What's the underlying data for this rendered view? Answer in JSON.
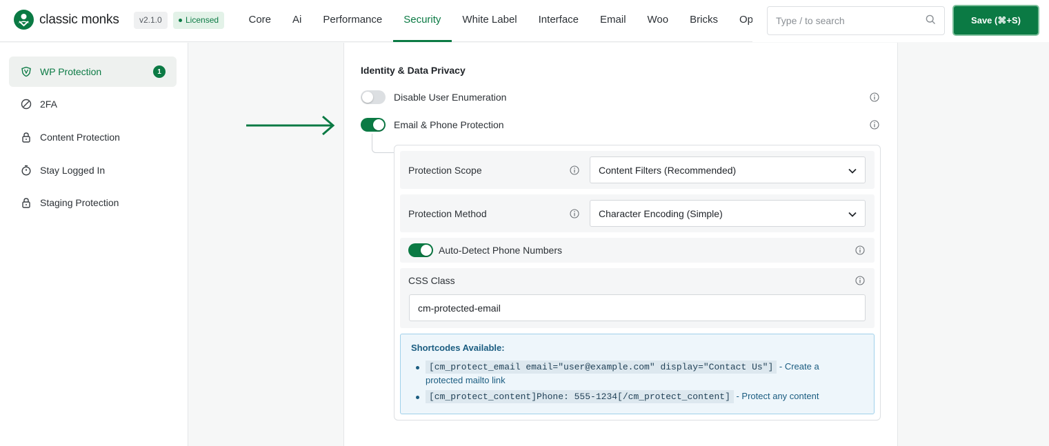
{
  "brand": {
    "name": "classic monks",
    "version": "v2.1.0",
    "license": "Licensed"
  },
  "nav": {
    "tabs": [
      "Core",
      "Ai",
      "Performance",
      "Security",
      "White Label",
      "Interface",
      "Email",
      "Woo",
      "Bricks",
      "Opt"
    ],
    "active_tab": "Security"
  },
  "search": {
    "placeholder": "Type / to search"
  },
  "save": {
    "label": "Save (⌘+S)"
  },
  "sidebar": {
    "items": [
      {
        "label": "WP Protection",
        "icon": "shield-icon",
        "badge": "1",
        "active": true
      },
      {
        "label": "2FA",
        "icon": "slash-circle-icon"
      },
      {
        "label": "Content Protection",
        "icon": "lock-icon"
      },
      {
        "label": "Stay Logged In",
        "icon": "stopwatch-icon"
      },
      {
        "label": "Staging Protection",
        "icon": "lock-icon"
      }
    ]
  },
  "section": {
    "title": "Identity & Data Privacy",
    "disable_user_enum": {
      "label": "Disable User Enumeration",
      "enabled": false
    },
    "email_phone": {
      "label": "Email & Phone Protection",
      "enabled": true
    }
  },
  "subpanel": {
    "scope": {
      "label": "Protection Scope",
      "value": "Content Filters (Recommended)"
    },
    "method": {
      "label": "Protection Method",
      "value": "Character Encoding (Simple)"
    },
    "auto_detect": {
      "label": "Auto-Detect Phone Numbers",
      "enabled": true
    },
    "css_class": {
      "label": "CSS Class",
      "value": "cm-protected-email"
    },
    "shortcodes": {
      "title": "Shortcodes Available:",
      "items": [
        {
          "code": "[cm_protect_email email=\"user@example.com\" display=\"Contact Us\"]",
          "desc": " - Create a protected mailto link"
        },
        {
          "code": "[cm_protect_content]Phone: 555-1234[/cm_protect_content]",
          "desc": " - Protect any content"
        }
      ]
    }
  },
  "colors": {
    "accent": "#0b7a44",
    "info_blue": "#1a5c80"
  }
}
